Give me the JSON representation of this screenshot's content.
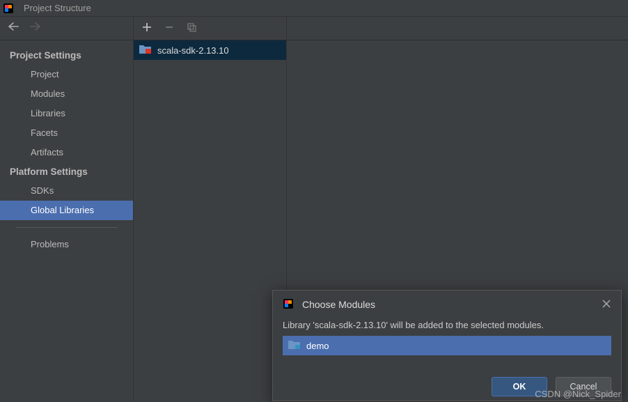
{
  "window": {
    "title": "Project Structure"
  },
  "nav": {
    "sections": [
      {
        "header": "Project Settings",
        "items": [
          "Project",
          "Modules",
          "Libraries",
          "Facets",
          "Artifacts"
        ]
      },
      {
        "header": "Platform Settings",
        "items": [
          "SDKs",
          "Global Libraries"
        ]
      }
    ],
    "extra_items": [
      "Problems"
    ],
    "selected": "Global Libraries"
  },
  "libraries": {
    "items": [
      {
        "name": "scala-sdk-2.13.10",
        "selected": true
      }
    ]
  },
  "dialog": {
    "title": "Choose Modules",
    "message": "Library 'scala-sdk-2.13.10' will be added to the selected modules.",
    "modules": [
      {
        "name": "demo",
        "selected": true
      }
    ],
    "ok_label": "OK",
    "cancel_label": "Cancel"
  },
  "watermark": "CSDN @Nick_Spider"
}
